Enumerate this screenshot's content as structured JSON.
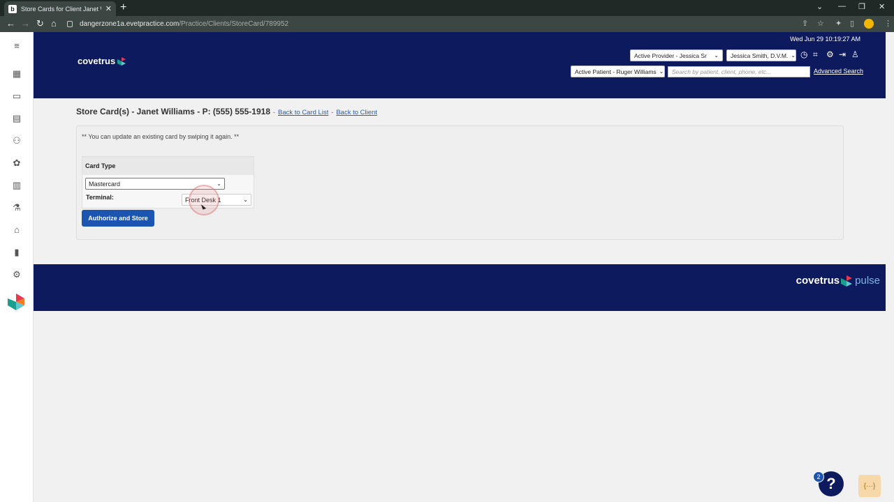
{
  "browser": {
    "tab_title": "Store Cards for Client Janet Willia",
    "tab_favicon": "b",
    "url_host": "dangerzone1a.evetpractice.com",
    "url_path": "/Practice/Clients/StoreCard/789952"
  },
  "rail": {
    "icons": [
      "menu-icon",
      "calendar-icon",
      "monitor-icon",
      "clipboard-icon",
      "people-icon",
      "paw-icon",
      "chart-icon",
      "flask-icon",
      "home-icon",
      "barcode-icon",
      "gear-icon"
    ]
  },
  "header": {
    "logo": "covetrus",
    "datetime": "Wed Jun 29 10:19:27 AM",
    "active_provider": "Active Provider - Jessica Sr",
    "user": "Jessica Smith, D.V.M.",
    "active_patient": "Active Patient - Ruger Williams",
    "search_placeholder": "Search by patient, client, phone, etc...",
    "advanced_search": "Advanced Search"
  },
  "main": {
    "title": "Store Card(s) - Janet Williams - P: (555) 555-1918",
    "separator": "-",
    "back_to_card_list": "Back to Card List",
    "back_to_client": "Back to Client",
    "note": "** You can update an existing card by swiping it again. **",
    "card_type_label": "Card Type",
    "card_type_value": "Mastercard",
    "terminal_label": "Terminal:",
    "terminal_value": "Front Desk 1",
    "authorize_button": "Authorize and Store"
  },
  "footer": {
    "logo": "covetrus",
    "logo_suffix": "pulse"
  },
  "help": {
    "badge": "2",
    "symbol": "?",
    "dev_widget": "{···}"
  },
  "colors": {
    "header_bg": "#0d1b5e",
    "button_bg": "#1c54b2",
    "link": "#2a5db0"
  }
}
